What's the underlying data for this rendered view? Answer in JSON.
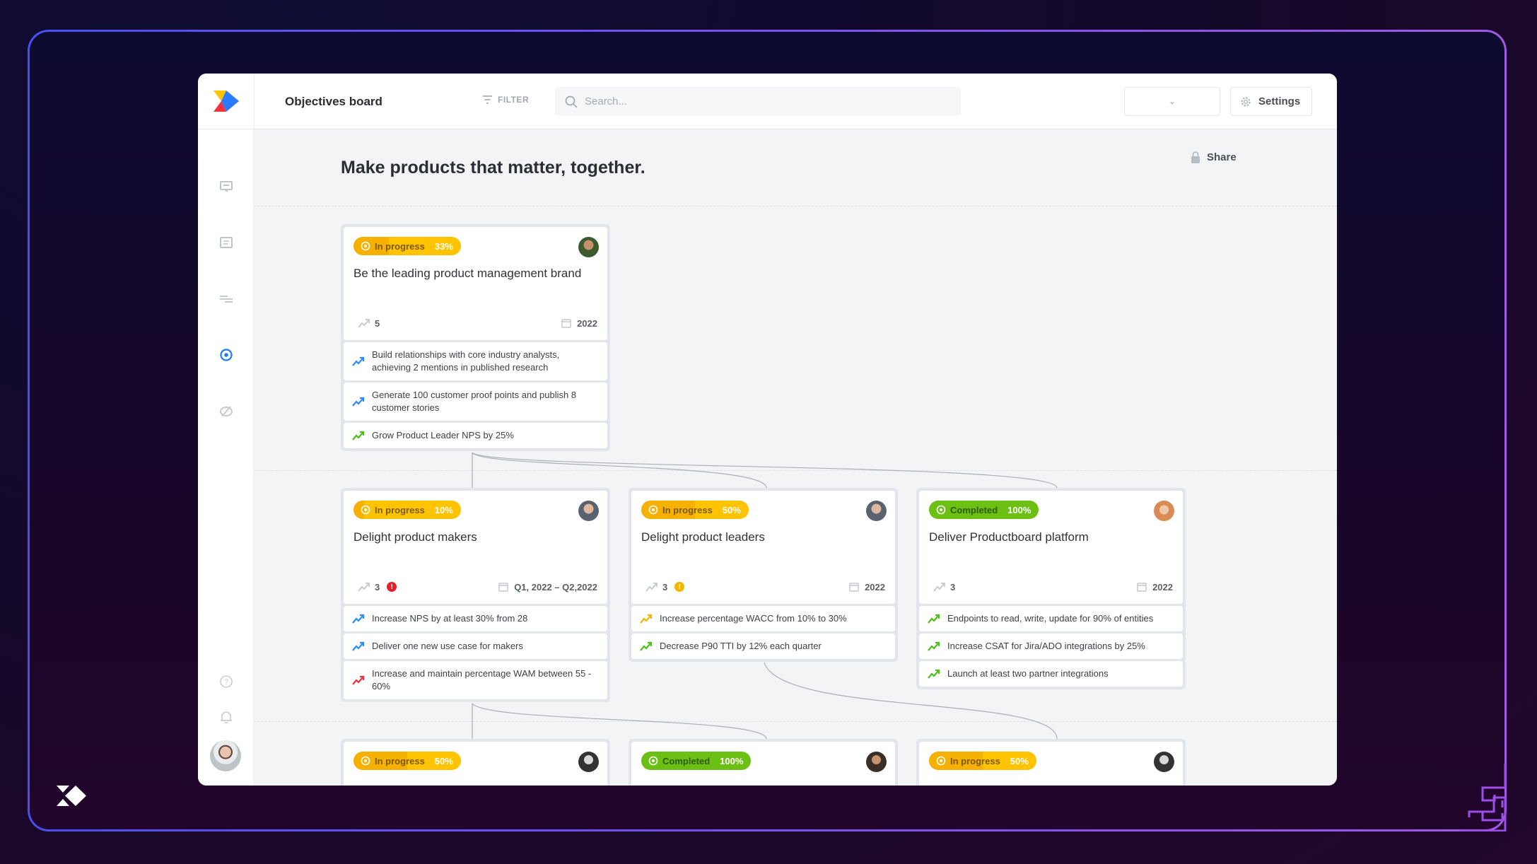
{
  "app": {
    "title": "Objectives board"
  },
  "toolbar": {
    "filter_label": "FILTER",
    "search_placeholder": "Search...",
    "share_label": "Share",
    "settings_label": "Settings"
  },
  "sidebar": {
    "items": [
      "insights-icon",
      "notes-icon",
      "roadmap-icon",
      "objectives-icon",
      "portal-icon"
    ],
    "active": "objectives-icon",
    "bottom": [
      "help-icon",
      "bell-icon"
    ]
  },
  "board": {
    "heading": "Make products that matter, together."
  },
  "colors": {
    "in_progress": "#ffc300",
    "in_progress_dark": "#f6b000",
    "completed": "#7ed321",
    "completed_dark": "#6cc014",
    "trend_blue": "#2a8cff",
    "trend_green": "#4cbf1a",
    "trend_yellow": "#f5b400",
    "trend_red": "#f0323c",
    "active_nav": "#1f7cff"
  },
  "cards": [
    {
      "status": "In progress",
      "percent": "33%",
      "progress": 33,
      "kind": "progress",
      "title": "Be the leading product management brand",
      "kr_count": "5",
      "date": "2022",
      "krs": [
        {
          "text": "Build relationships with core industry analysts, achieving 2 mentions in published research",
          "trend": "blue"
        },
        {
          "text": "Generate 100 customer proof points and publish 8 customer stories",
          "trend": "blue"
        },
        {
          "text": "Grow Product Leader NPS by 25%",
          "trend": "green"
        }
      ]
    },
    {
      "status": "In progress",
      "percent": "10%",
      "progress": 10,
      "kind": "progress",
      "title": "Delight product makers",
      "kr_count": "3",
      "alert": "!",
      "alert_color": "red",
      "date": "Q1, 2022 – Q2,2022",
      "krs": [
        {
          "text": "Increase NPS by at least 30% from 28",
          "trend": "blue"
        },
        {
          "text": "Deliver one new use case for makers",
          "trend": "blue"
        },
        {
          "text": "Increase and maintain percentage WAM between 55 - 60%",
          "trend": "red"
        }
      ]
    },
    {
      "status": "In progress",
      "percent": "50%",
      "progress": 50,
      "kind": "progress",
      "title": "Delight product leaders",
      "kr_count": "3",
      "alert": "!",
      "alert_color": "yellow",
      "date": "2022",
      "krs": [
        {
          "text": "Increase percentage WACC from 10% to 30%",
          "trend": "yellow"
        },
        {
          "text": "Decrease P90 TTI by 12% each quarter",
          "trend": "green"
        }
      ]
    },
    {
      "status": "Completed",
      "percent": "100%",
      "progress": 100,
      "kind": "done",
      "title": "Deliver Productboard platform",
      "kr_count": "3",
      "date": "2022",
      "krs": [
        {
          "text": "Endpoints to read, write, update for 90% of entities",
          "trend": "green"
        },
        {
          "text": "Increase CSAT for Jira/ADO integrations by 25%",
          "trend": "green"
        },
        {
          "text": "Launch at least two partner integrations",
          "trend": "green"
        }
      ]
    },
    {
      "status": "In progress",
      "percent": "50%",
      "progress": 50,
      "kind": "progress"
    },
    {
      "status": "Completed",
      "percent": "100%",
      "progress": 100,
      "kind": "done"
    },
    {
      "status": "In progress",
      "percent": "50%",
      "progress": 50,
      "kind": "progress"
    }
  ]
}
